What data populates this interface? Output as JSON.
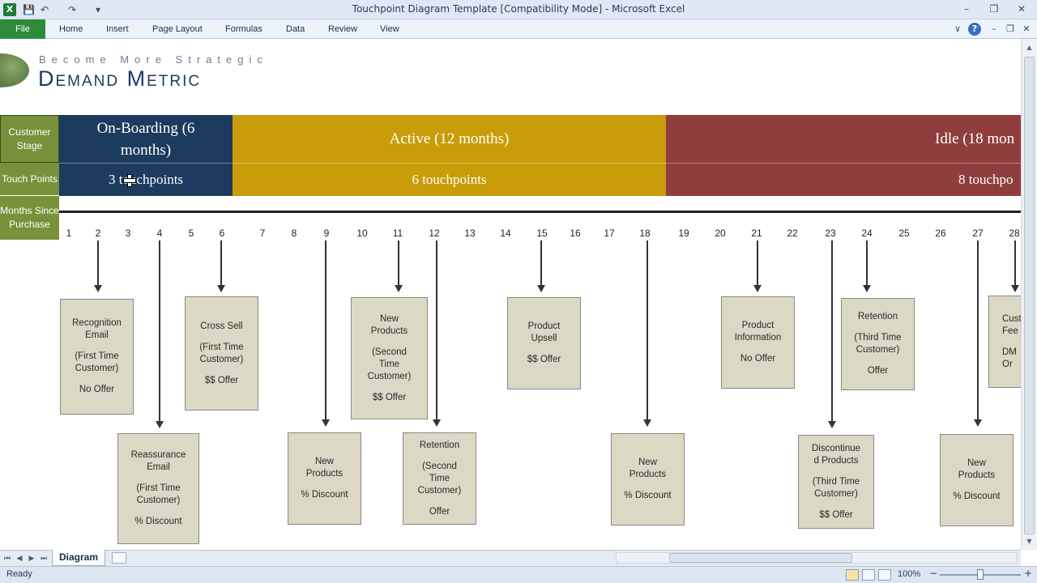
{
  "window": {
    "title": "Touchpoint Diagram Template  [Compatibility Mode]  -  Microsoft Excel",
    "app_icon": "X"
  },
  "qat": {
    "save_icon": "💾",
    "undo_icon": "↶",
    "redo_icon": "↷",
    "customize_icon": "▾"
  },
  "window_controls": {
    "minimize": "–",
    "restore": "❐",
    "close": "✕"
  },
  "ribbon": {
    "file_tab": "File",
    "tabs": [
      "Home",
      "Insert",
      "Page Layout",
      "Formulas",
      "Data",
      "Review",
      "View"
    ],
    "collapse_icon": "∨",
    "help_icon": "?",
    "doc_minimize": "–",
    "doc_restore": "❐",
    "doc_close": "✕"
  },
  "logo": {
    "tagline": "Become More Strategic",
    "name": "Demand Metric"
  },
  "row_labels": {
    "stage": "Customer Stage",
    "touch": "Touch Points",
    "months": "Months Since Purchase"
  },
  "stages": [
    {
      "name": "On-Boarding (6 months)",
      "touchpoints": "3 touchpoints"
    },
    {
      "name": "Active (12 months)",
      "touchpoints": "6 touchpoints"
    },
    {
      "name": "Idle (18 mon",
      "touchpoints": "8 touchpo"
    }
  ],
  "months": [
    "1",
    "2",
    "3",
    "4",
    "5",
    "6",
    "7",
    "8",
    "9",
    "10",
    "11",
    "12",
    "13",
    "14",
    "15",
    "16",
    "17",
    "18",
    "19",
    "20",
    "21",
    "22",
    "23",
    "24",
    "25",
    "26",
    "27",
    "28"
  ],
  "touchpoints": [
    {
      "lines": [
        "Recognition",
        "Email",
        "",
        "(First Time",
        "Customer)",
        "",
        "No Offer"
      ]
    },
    {
      "lines": [
        "Reassurance",
        "Email",
        "",
        "(First Time",
        "Customer)",
        "",
        "% Discount"
      ]
    },
    {
      "lines": [
        "Cross Sell",
        "",
        "(First Time",
        "Customer)",
        "",
        "$$ Offer"
      ]
    },
    {
      "lines": [
        "New",
        "Products",
        "",
        "% Discount"
      ]
    },
    {
      "lines": [
        "New",
        "Products",
        "",
        "(Second",
        "Time",
        "Customer)",
        "",
        "$$ Offer"
      ]
    },
    {
      "lines": [
        "Retention",
        "",
        "(Second",
        "Time",
        "Customer)",
        "",
        "Offer"
      ]
    },
    {
      "lines": [
        "Product",
        "Upsell",
        "",
        "$$ Offer"
      ]
    },
    {
      "lines": [
        "New",
        "Products",
        "",
        "% Discount"
      ]
    },
    {
      "lines": [
        "Product",
        "Information",
        "",
        "No Offer"
      ]
    },
    {
      "lines": [
        "Discontinue",
        "d Products",
        "",
        "(Third Time",
        "Customer)",
        "",
        "$$ Offer"
      ]
    },
    {
      "lines": [
        "Retention",
        "",
        "(Third Time",
        "Customer)",
        "",
        "Offer"
      ]
    },
    {
      "lines": [
        "New",
        "Products",
        "",
        "% Discount"
      ]
    },
    {
      "lines": [
        "Cust",
        "Fee",
        "",
        "DM",
        "Or"
      ]
    }
  ],
  "sheet_tabs": {
    "nav": [
      "⏮",
      "◀",
      "▶",
      "⏭"
    ],
    "active": "Diagram"
  },
  "status": {
    "ready": "Ready",
    "zoom": "100%",
    "zoom_out": "−",
    "zoom_in": "+"
  }
}
